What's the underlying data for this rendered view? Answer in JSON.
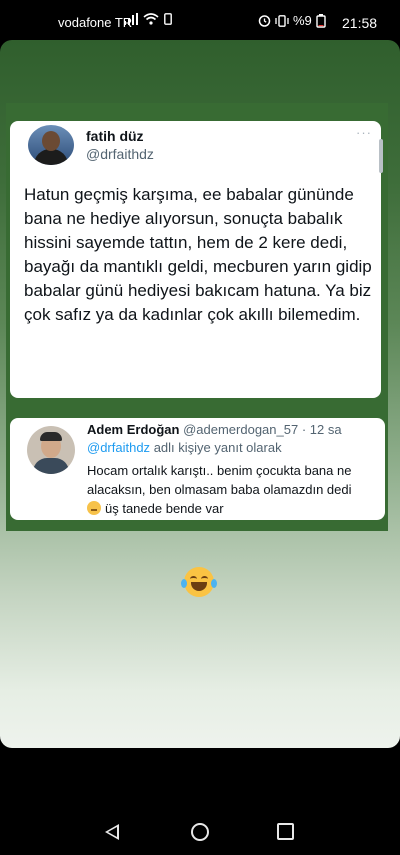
{
  "status_bar": {
    "carrier": "vodafone TR",
    "battery": "%9",
    "time": "21:58"
  },
  "tweet": {
    "author_name": "fatih düz",
    "author_handle": "@drfaithdz",
    "more": "···",
    "text": "Hatun geçmiş karşıma, ee babalar gününde bana ne hediye alıyorsun, sonuçta babalık hissini sayemde tattın, hem de 2 kere dedi, bayağı da mantıklı geldi, mecburen yarın gidip babalar günü hediyesi bakıcam hatuna. Ya biz çok safız ya da kadınlar çok akıllı bilemedim."
  },
  "reply": {
    "author_name": "Adem Erdoğan",
    "author_handle": "@ademerdogan_57",
    "time": "· 12 sa",
    "reply_mention": "@drfaithdz",
    "reply_suffix": "adlı kişiye yanıt olarak",
    "text_line1": "Hocam ortalık karıştı.. benim çocukta bana ne alacaksın, ben olmasam baba olamazdın dedi",
    "text_line2": "üş tanede bende var"
  },
  "icons": {
    "story_emoji": "laughing-tears-icon",
    "nav": [
      "back-icon",
      "home-icon",
      "recents-icon"
    ]
  }
}
